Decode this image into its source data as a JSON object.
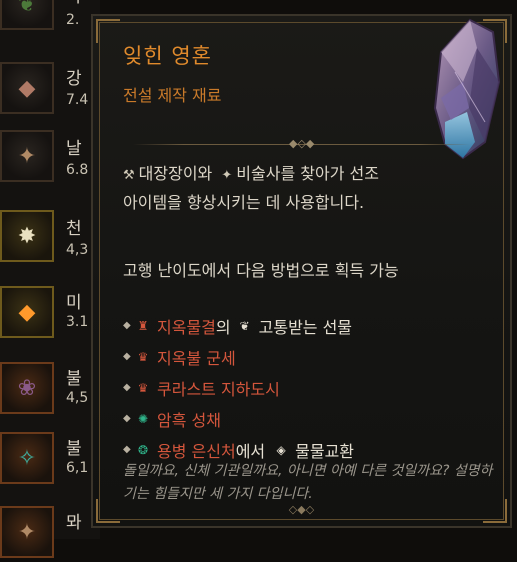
{
  "inventory": [
    {
      "name": "악",
      "num": "2."
    },
    {
      "name": "강",
      "num": "7.4"
    },
    {
      "name": "날",
      "num": "6.8"
    },
    {
      "name": "천",
      "num": "4,3"
    },
    {
      "name": "미",
      "num": "3.1"
    },
    {
      "name": "불",
      "num": "4,5"
    },
    {
      "name": "불",
      "num": "6,1"
    },
    {
      "name": "뫄",
      "num": ""
    }
  ],
  "tooltip": {
    "title": "잊힌 영혼",
    "subtitle": "전설 제작 재료",
    "description": {
      "line1": {
        "blacksmith": "대장장이",
        "conj": "와",
        "occultist": "비술사",
        "rest": "를 찾아가 선조"
      },
      "line2": "아이템을 향상시키는 데 사용합니다."
    },
    "acquisition_heading": "고행 난이도에서 다음 방법으로 획득 가능",
    "sources": [
      {
        "icon": "hell-tide-icon",
        "label": "지옥물결",
        "suffix": "의",
        "icon2": "tortured-gift-icon",
        "label2": "고통받는 선물"
      },
      {
        "icon": "hell-army-icon",
        "label": "지옥불 군세"
      },
      {
        "icon": "dungeon-icon",
        "label": "쿠라스트 지하도시"
      },
      {
        "icon": "dark-citadel-icon",
        "label": "암흑 성채"
      },
      {
        "icon": "mercenary-icon",
        "label": "용병 은신처",
        "suffix": "에서",
        "icon2": "barter-icon",
        "label2": "물물교환"
      }
    ],
    "flavor": "돌일까요, 신체 기관일까요, 아니면 아예 다른 것일까요? 설명하기는 힘들지만 세 가지 다입니다."
  },
  "colors": {
    "title": "#e08a2c",
    "red_source": "#d4563c",
    "green_source": "#2fb48a",
    "body_text": "#dcd6c8",
    "flavor_text": "#9b968c"
  }
}
